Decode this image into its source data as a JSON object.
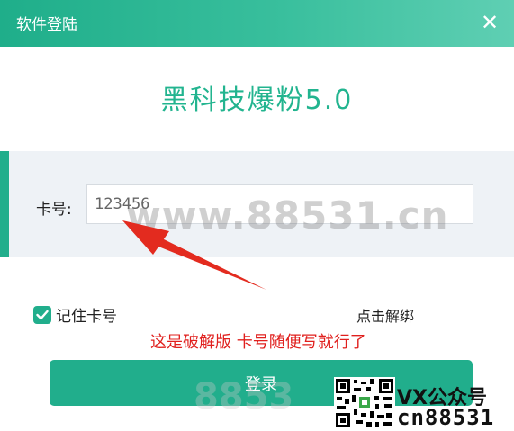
{
  "window": {
    "title": "软件登陆",
    "close_icon": "close-icon"
  },
  "heading": "黑科技爆粉5.0",
  "login_form": {
    "card_label": "卡号:",
    "card_value": "123456",
    "remember_label": "记住卡号",
    "remember_checked": true,
    "unbind_label": "点击解绑",
    "login_label": "登录"
  },
  "annotation": {
    "note": "这是破解版  卡号随便写就行了"
  },
  "watermarks": {
    "main": "www.88531.cn",
    "faint": "8853",
    "vx": "VX公众号",
    "cn": "cn88531"
  },
  "colors": {
    "accent": "#21ae8c",
    "note": "#e0201e",
    "panel": "#eef2f6"
  }
}
